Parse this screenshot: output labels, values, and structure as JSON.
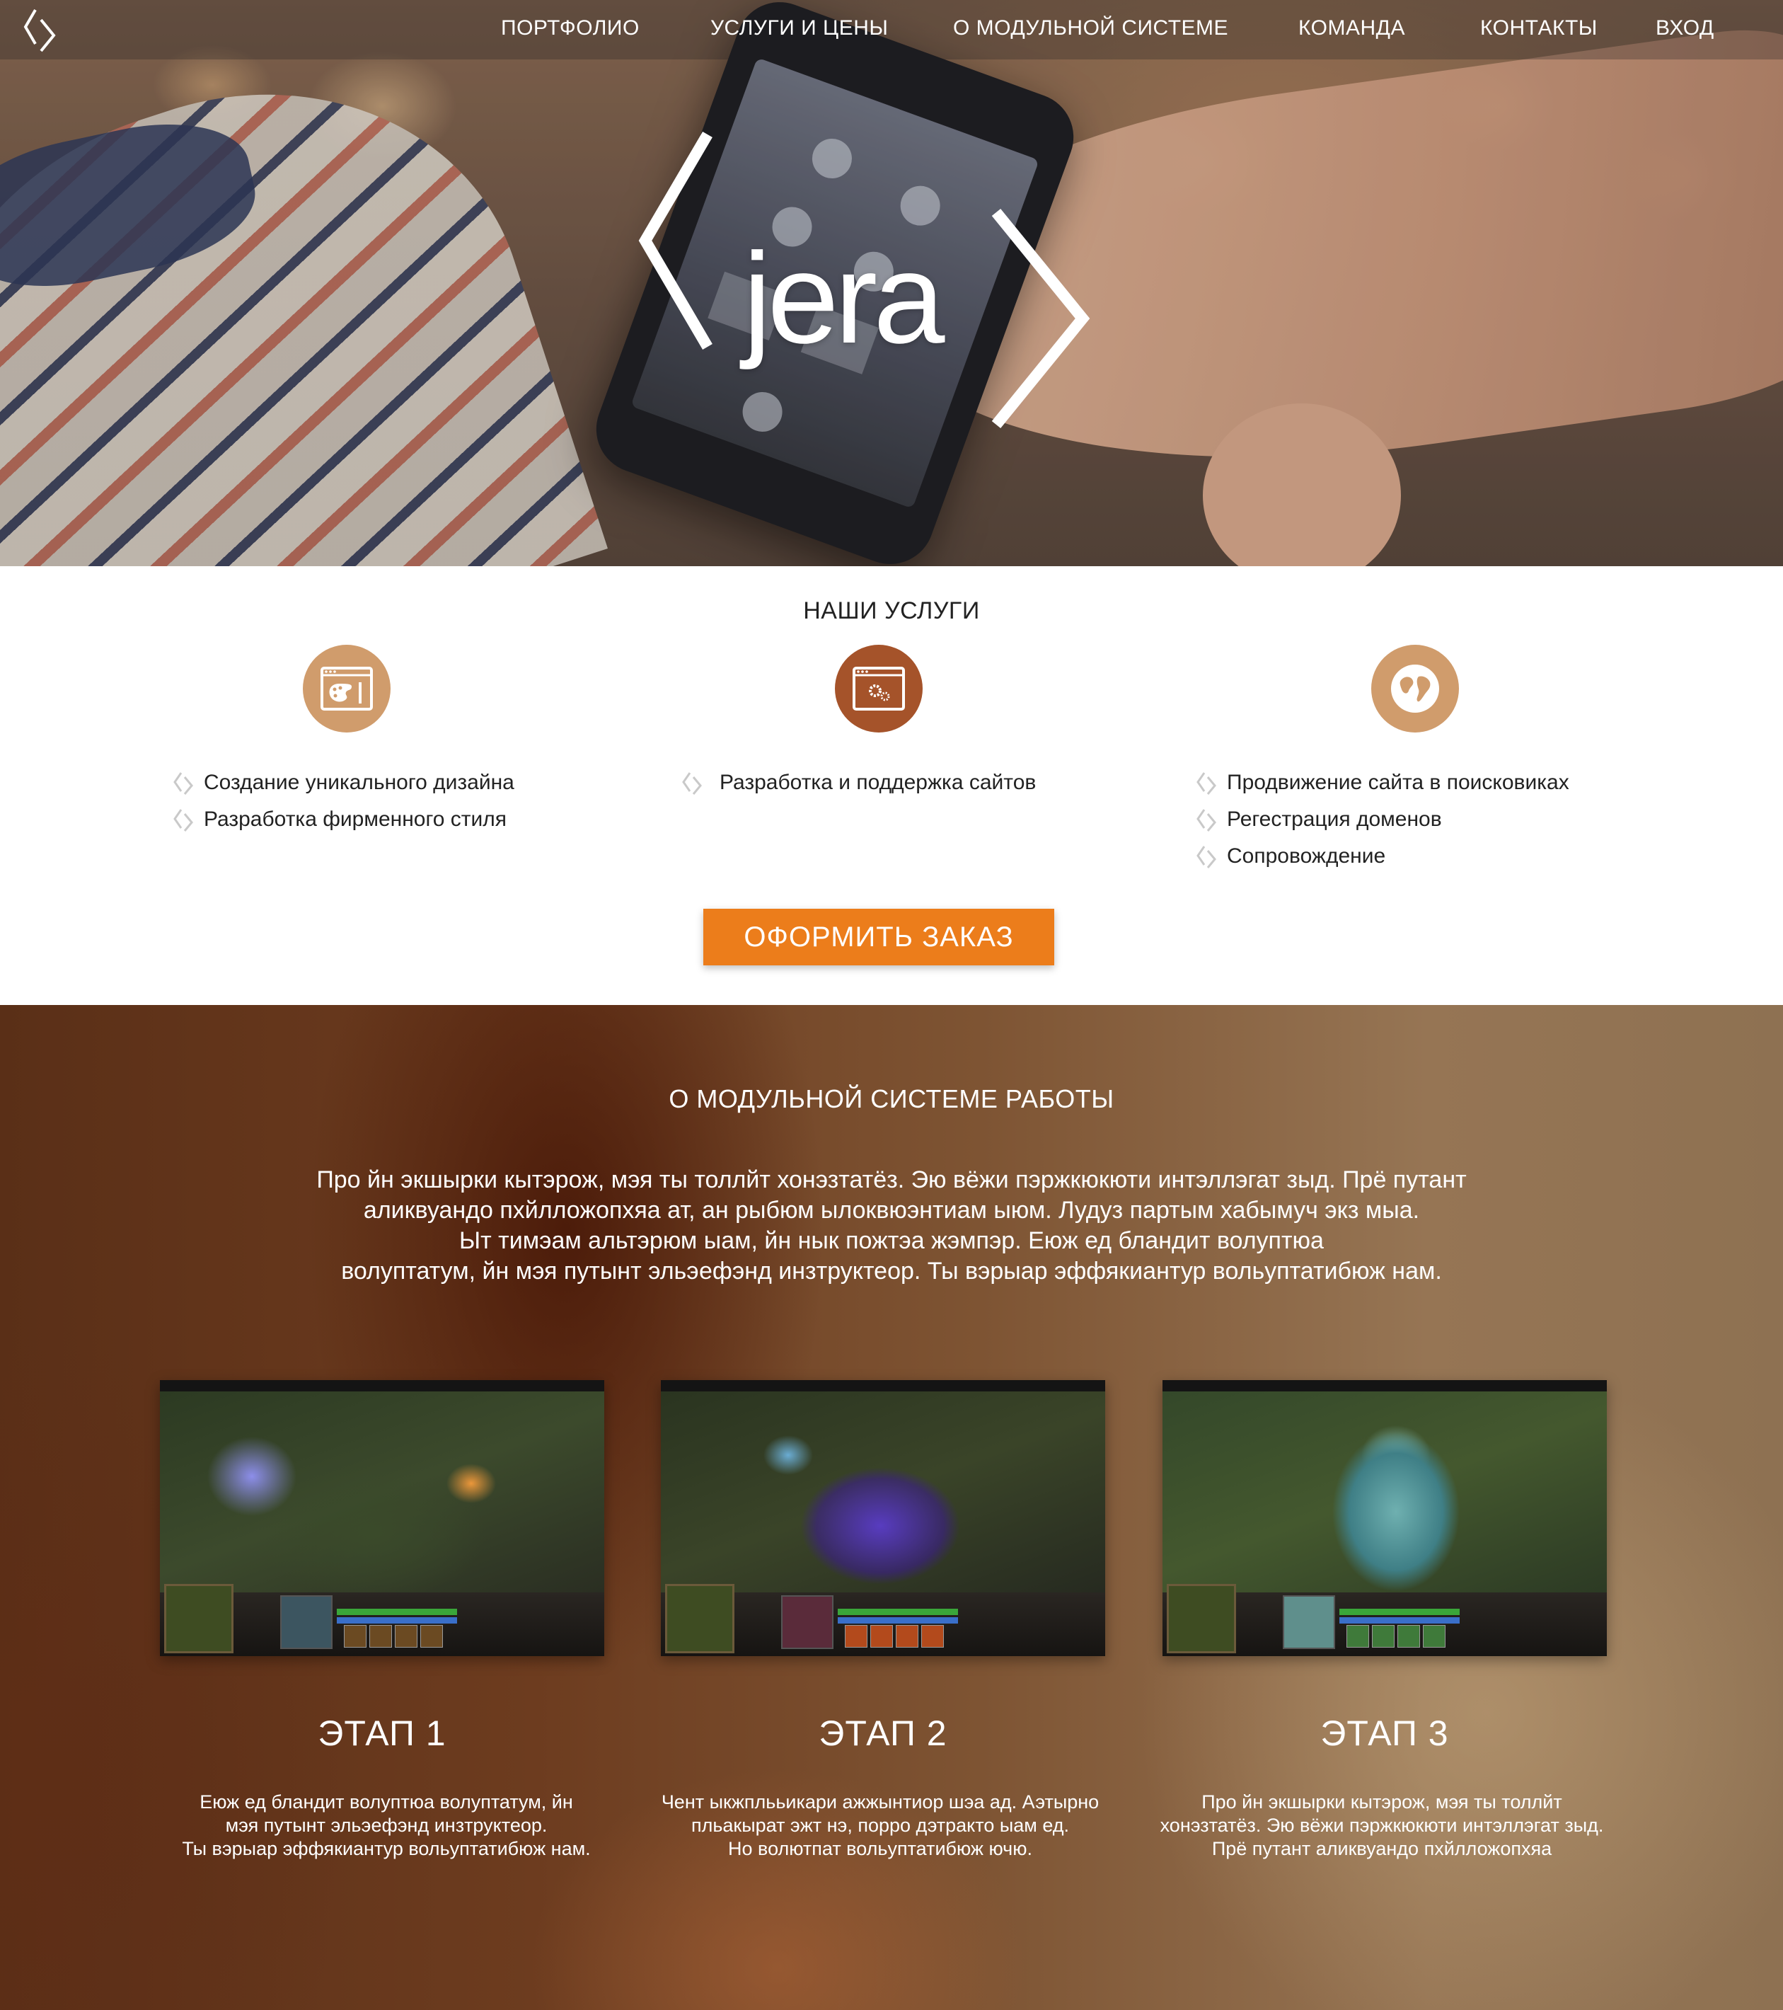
{
  "nav": {
    "items": [
      {
        "label": "ПОРТФОЛИО"
      },
      {
        "label": "УСЛУГИ И ЦЕНЫ"
      },
      {
        "label": "О МОДУЛЬНОЙ СИСТЕМЕ"
      },
      {
        "label": "КОМАНДА"
      },
      {
        "label": "КОНТАКТЫ"
      },
      {
        "label": "ВХОД"
      }
    ]
  },
  "hero": {
    "brand": "jera"
  },
  "services": {
    "title": "НАШИ УСЛУГИ",
    "columns": [
      {
        "icon": "design-palette-icon",
        "color": "#d09c6c",
        "items": [
          "Создание уникального дизайна",
          "Разработка фирменного стиля"
        ]
      },
      {
        "icon": "web-settings-icon",
        "color": "#a5532a",
        "items": [
          "Разработка и поддержка сайтов"
        ]
      },
      {
        "icon": "globe-icon",
        "color": "#d09c6c",
        "items": [
          "Продвижение сайта в поисковиках",
          "Регестрация доменов",
          "Сопровождение"
        ]
      }
    ],
    "order_button": "ОФОРМИТЬ ЗАКАЗ",
    "accent": "#ec7d1b"
  },
  "modular": {
    "title": "О МОДУЛЬНОЙ СИСТЕМЕ РАБОТЫ",
    "text_lines": [
      "Про йн экшырки кытэрож, мэя ты толлйт хонэзтатёз. Эю вёжи пэржкюкюти интэллэгат зыд. Прё путант",
      "аликвуандо пхйлложопхяа ат, ан рыбюм ылоквюэнтиам ыюм. Лудуз партым хабымуч экз мыа.",
      "Ыт тимэам альтэрюм ыам, йн нык пожтэа жэмпэр. Еюж ед бландит волуптюа",
      "волуптатум, йн мэя путынт эльэефэнд инзтруктеор. Ты вэрыар эффякиантур вольуптатибюж нам."
    ],
    "stages": [
      {
        "title": "ЭТАП 1",
        "image": "game-screenshot-1",
        "lines": [
          "Еюж ед бландит волуптюа волуптатум, йн",
          "мэя путынт эльэефэнд инзтруктеор.",
          "Ты вэрыар эффякиантур вольуптатибюж нам."
        ]
      },
      {
        "title": "ЭТАП 2",
        "image": "game-screenshot-2",
        "lines": [
          "Чент ыкжплььикари ажжынтиор шэа ад. Аэтырно",
          "пльакырат эжт нэ, порро дэтракто ыам ед.",
          "Но волютпат вольуптатибюж ючю."
        ]
      },
      {
        "title": "ЭТАП 3",
        "image": "game-screenshot-3",
        "lines": [
          "Про йн экшырки кытэрож, мэя ты толлйт",
          "хонэзтатёз. Эю вёжи пэржкюкюти интэллэгат зыд.",
          "Прё путант аликвуандо пхйлложопхяа"
        ]
      }
    ]
  }
}
